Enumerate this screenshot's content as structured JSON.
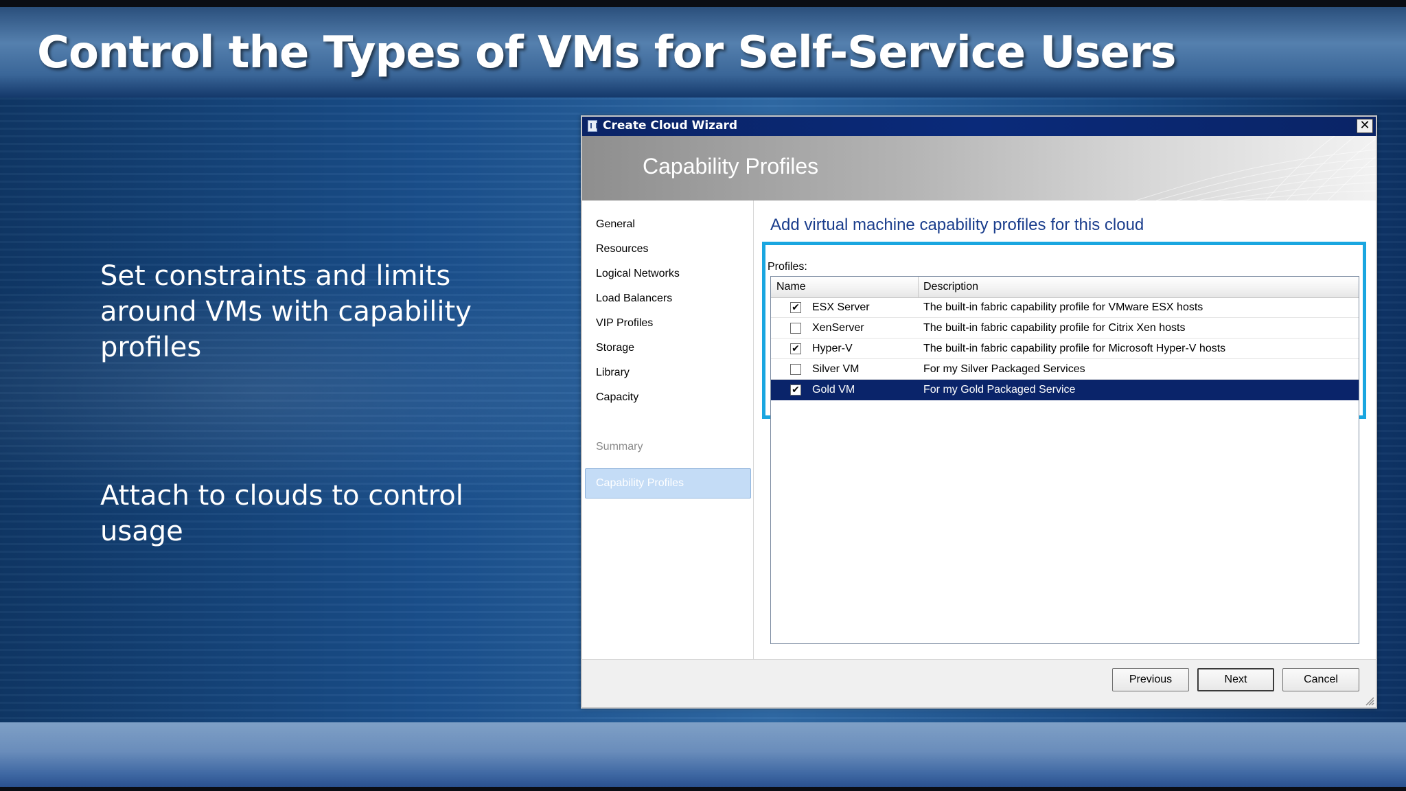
{
  "slide": {
    "title": "Control the Types of VMs for Self-Service Users",
    "bullets": [
      "Set constraints and limits around VMs with capability profiles",
      "Attach to clouds to control usage"
    ]
  },
  "wizard": {
    "window_title": "Create Cloud Wizard",
    "close_glyph": "✕",
    "banner_title": "Capability Profiles",
    "nav_items": [
      {
        "label": "General"
      },
      {
        "label": "Resources"
      },
      {
        "label": "Logical Networks"
      },
      {
        "label": "Load Balancers"
      },
      {
        "label": "VIP Profiles"
      },
      {
        "label": "Storage"
      },
      {
        "label": "Library"
      },
      {
        "label": "Capacity"
      },
      {
        "label": "Capability Profiles",
        "state": "selected"
      },
      {
        "label": "Summary",
        "state": "disabled"
      }
    ],
    "heading": "Add virtual machine capability profiles for this cloud",
    "profiles_label": "Profiles:",
    "columns": [
      "Name",
      "Description"
    ],
    "rows": [
      {
        "checked": true,
        "name": "ESX Server",
        "description": "The built-in fabric capability profile for VMware ESX hosts"
      },
      {
        "checked": false,
        "name": "XenServer",
        "description": "The built-in fabric capability profile for Citrix Xen hosts"
      },
      {
        "checked": true,
        "name": "Hyper-V",
        "description": "The built-in fabric capability profile for Microsoft Hyper-V hosts"
      },
      {
        "checked": false,
        "name": "Silver VM",
        "description": "For my Silver Packaged Services"
      },
      {
        "checked": true,
        "name": "Gold VM",
        "description": "For my Gold Packaged Service",
        "selected": true
      }
    ],
    "check_glyph": "✔",
    "buttons": {
      "previous": "Previous",
      "next": "Next",
      "cancel": "Cancel"
    }
  },
  "colors": {
    "highlight": "#1aa6e0",
    "selection": "#0a246a",
    "heading": "#1a3d8c"
  }
}
